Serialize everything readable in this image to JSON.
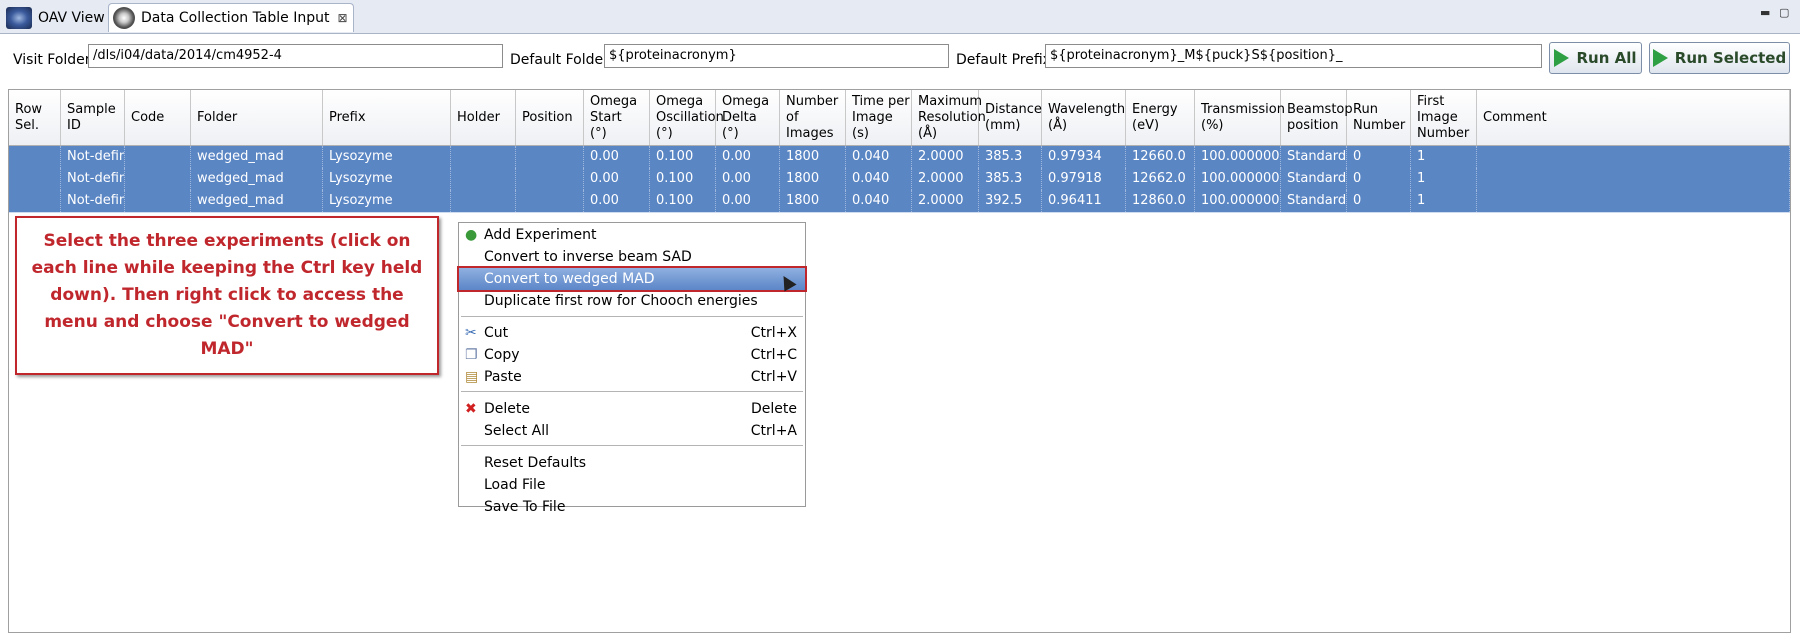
{
  "tabs": [
    {
      "label": "OAV View",
      "icon": "oav-view-icon"
    },
    {
      "label": "Data Collection Table Input",
      "icon": "data-collection-icon"
    }
  ],
  "tab_close_glyph": "⊠",
  "window_controls": {
    "minimize": "▬",
    "maximize": "▢"
  },
  "toolbar": {
    "visit_folder_label": "Visit Folder",
    "visit_folder_value": "/dls/i04/data/2014/cm4952-4",
    "default_folder_label": "Default Folder",
    "default_folder_value": "${proteinacronym}",
    "default_prefix_label": "Default Prefix",
    "default_prefix_value": "${proteinacronym}_M${puck}S${position}_",
    "run_all_label": "Run All",
    "run_selected_label": "Run Selected"
  },
  "table": {
    "headers": [
      "Row\nSel.",
      "Sample\nID",
      "Code",
      "Folder",
      "Prefix",
      "Holder",
      "Position",
      "Omega\nStart\n(°)",
      "Omega\nOscillation\n(°)",
      "Omega\nDelta\n(°)",
      "Number\nof\nImages",
      "Time per\nImage\n(s)",
      "Maximum\nResolution\n(Å)",
      "Distance\n(mm)",
      "Wavelength\n(Å)",
      "Energy\n(eV)",
      "Transmission\n(%)",
      "Beamstop\nposition",
      "Run\nNumber",
      "First\nImage\nNumber",
      "Comment"
    ],
    "rows": [
      [
        "",
        "Not-defined",
        "",
        "wedged_mad",
        "Lysozyme",
        "",
        "",
        "0.00",
        "0.100",
        "0.00",
        "1800",
        "0.040",
        "2.0000",
        "385.3",
        "0.97934",
        "12660.0",
        "100.000000",
        "Standard",
        "0",
        "1",
        ""
      ],
      [
        "",
        "Not-defined",
        "",
        "wedged_mad",
        "Lysozyme",
        "",
        "",
        "0.00",
        "0.100",
        "0.00",
        "1800",
        "0.040",
        "2.0000",
        "385.3",
        "0.97918",
        "12662.0",
        "100.000000",
        "Standard",
        "0",
        "1",
        ""
      ],
      [
        "",
        "Not-defined",
        "",
        "wedged_mad",
        "Lysozyme",
        "",
        "",
        "0.00",
        "0.100",
        "0.00",
        "1800",
        "0.040",
        "2.0000",
        "392.5",
        "0.96411",
        "12860.0",
        "100.000000",
        "Standard",
        "0",
        "1",
        ""
      ]
    ]
  },
  "annotation": "Select the three experiments (click on each line while keeping the Ctrl key held down). Then right click to access the menu and choose  \"Convert to wedged MAD\"",
  "context_menu": {
    "items": [
      {
        "label": "Add Experiment",
        "shortcut": "",
        "icon": "add-icon"
      },
      {
        "label": "Convert to inverse beam SAD",
        "shortcut": "",
        "icon": ""
      },
      {
        "label": "Convert to wedged MAD",
        "shortcut": "",
        "icon": "",
        "highlighted": true
      },
      {
        "label": "Duplicate first row for Chooch energies",
        "shortcut": "",
        "icon": ""
      },
      {
        "label": "Cut",
        "shortcut": "Ctrl+X",
        "icon": "scissors-icon"
      },
      {
        "label": "Copy",
        "shortcut": "Ctrl+C",
        "icon": "copy-icon"
      },
      {
        "label": "Paste",
        "shortcut": "Ctrl+V",
        "icon": "paste-icon"
      },
      {
        "label": "Delete",
        "shortcut": "Delete",
        "icon": "delete-icon"
      },
      {
        "label": "Select All",
        "shortcut": "Ctrl+A",
        "icon": ""
      },
      {
        "label": "Reset Defaults",
        "shortcut": "",
        "icon": ""
      },
      {
        "label": "Load File",
        "shortcut": "",
        "icon": ""
      },
      {
        "label": "Save To File",
        "shortcut": "",
        "icon": ""
      }
    ]
  },
  "colors": {
    "selection": "#5b86c4",
    "annotation": "#c0272d",
    "run_icon": "#2ea043"
  }
}
